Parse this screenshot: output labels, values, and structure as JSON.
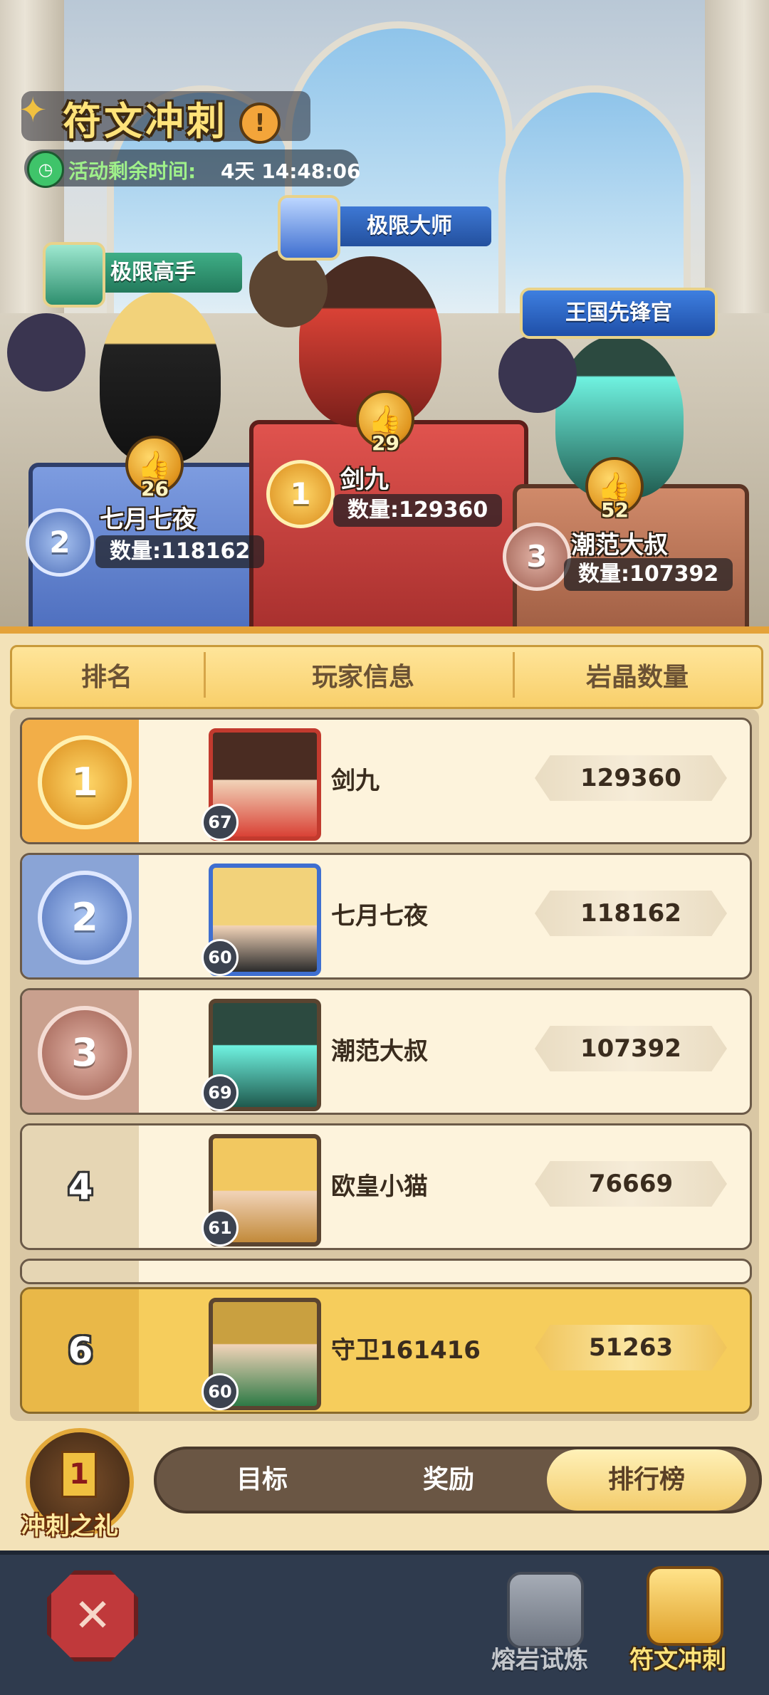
{
  "event": {
    "title": "符文冲刺",
    "timer_label": "活动剩余时间:",
    "timer_value": "4天 14:48:06"
  },
  "podium": [
    {
      "rank": "1",
      "title": "极限大师",
      "name": "剑九",
      "likes": "29",
      "count_label": "数量:",
      "count": "129360"
    },
    {
      "rank": "2",
      "title": "极限高手",
      "name": "七月七夜",
      "likes": "26",
      "count_label": "数量:",
      "count": "118162"
    },
    {
      "rank": "3",
      "title": "王国先锋官",
      "name": "潮范大叔",
      "likes": "52",
      "count_label": "数量:",
      "count": "107392"
    }
  ],
  "table_header": {
    "rank": "排名",
    "player": "玩家信息",
    "amount": "岩晶数量"
  },
  "rows": [
    {
      "rank": "1",
      "level": "67",
      "name": "剑九",
      "score": "129360"
    },
    {
      "rank": "2",
      "level": "60",
      "name": "七月七夜",
      "score": "118162"
    },
    {
      "rank": "3",
      "level": "69",
      "name": "潮范大叔",
      "score": "107392"
    },
    {
      "rank": "4",
      "level": "61",
      "name": "欧皇小猫",
      "score": "76669"
    }
  ],
  "my_row": {
    "rank": "6",
    "level": "60",
    "name": "守卫161416",
    "score": "51263"
  },
  "gift": {
    "label": "冲刺之礼",
    "badge": "1"
  },
  "tabs": {
    "goal": "目标",
    "reward": "奖励",
    "ranking": "排行榜",
    "active": "ranking"
  },
  "bottom_nav": {
    "trial": "熔岩试炼",
    "sprint": "符文冲刺"
  },
  "colors": {
    "gold": "#f3c24a",
    "silver": "#8aa4d6",
    "bronze": "#c9a08e",
    "accent": "#e4a23a"
  }
}
